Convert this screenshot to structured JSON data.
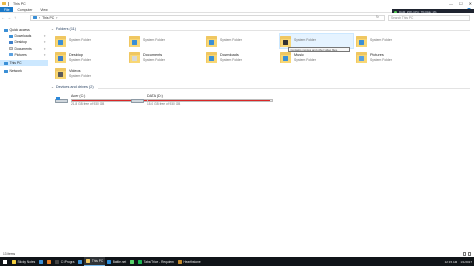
{
  "window": {
    "title": "This PC",
    "controls": [
      "—",
      "☐",
      "✕"
    ]
  },
  "ribbon": {
    "tabs": [
      "File",
      "Computer",
      "View"
    ],
    "help": "?"
  },
  "address": {
    "back": "←",
    "forward": "→",
    "up": "↑",
    "path": "This PC",
    "chevron": "›",
    "refresh": "↻",
    "search_placeholder": "Search This PC"
  },
  "meter": {
    "text": "RAM: 25%  CPU: 7%  Disk: 1%"
  },
  "sidebar": {
    "items": [
      {
        "label": "Quick access",
        "icon": "star-icon",
        "pinned": false
      },
      {
        "label": "Downloads",
        "icon": "download-icon",
        "pinned": true
      },
      {
        "label": "Desktop",
        "icon": "desktop-icon",
        "pinned": true
      },
      {
        "label": "Documents",
        "icon": "document-icon",
        "pinned": true
      },
      {
        "label": "Pictures",
        "icon": "pictures-icon",
        "pinned": true
      },
      {
        "label": "This PC",
        "icon": "computer-icon",
        "pinned": false
      },
      {
        "label": "Network",
        "icon": "network-icon",
        "pinned": false
      }
    ]
  },
  "folders": {
    "header": "Folders (11)",
    "items": [
      {
        "name": "",
        "type": "System Folder",
        "glyph_color": "#3a8fd6"
      },
      {
        "name": "",
        "type": "System Folder",
        "glyph_color": "#3a8fd6"
      },
      {
        "name": "",
        "type": "System Folder",
        "glyph_color": "#3a8fd6"
      },
      {
        "name": "",
        "type": "System Folder",
        "glyph_color": "#3a8fd6"
      },
      {
        "name": "",
        "type": "System Folder",
        "glyph_color": "#333333"
      },
      {
        "name": "",
        "type": "System Folder",
        "glyph_color": "#3a8fd6"
      },
      {
        "name": "Desktop",
        "type": "System Folder",
        "glyph_color": "#3d7ec9"
      },
      {
        "name": "Documents",
        "type": "System Folder",
        "glyph_color": "#d8d8d8"
      },
      {
        "name": "Downloads",
        "type": "System Folder",
        "glyph_color": "#3a8fd6"
      },
      {
        "name": "Music",
        "type": "System Folder",
        "glyph_color": "#3a8fd6"
      },
      {
        "name": "Pictures",
        "type": "System Folder",
        "glyph_color": "#5aa0e0"
      },
      {
        "name": "Videos",
        "type": "System Folder",
        "glyph_color": "#5a5a5a"
      }
    ],
    "tooltip": "Contains movies and other video files."
  },
  "drives": {
    "header": "Devices and drives (2)",
    "items": [
      {
        "name": "Acer (C:)",
        "free": "21.8 GB free of 930 GB",
        "used_fraction": 0.98
      },
      {
        "name": "DATA (D:)",
        "free": "15.0 GB free of 930 GB",
        "used_fraction": 0.98
      }
    ]
  },
  "status": {
    "count": "13 items"
  },
  "taskbar": {
    "items": [
      {
        "label": "Sticky Notes",
        "color": "#f4d03f",
        "active": false
      },
      {
        "label": "",
        "color": "#3a8fd6",
        "active": false
      },
      {
        "label": "",
        "color": "#e67e22",
        "active": false
      },
      {
        "label": "C:\\Progra",
        "color": "#444444",
        "active": false
      },
      {
        "label": "",
        "color": "#3a8fd6",
        "active": false
      },
      {
        "label": "This PC",
        "color": "#f0c761",
        "active": true
      },
      {
        "label": "Battle.net",
        "color": "#2a8cd8",
        "active": false
      },
      {
        "label": "",
        "color": "#58d26b",
        "active": false
      },
      {
        "label": "Tabs/Trice - Requiem",
        "color": "#1db954",
        "active": false
      },
      {
        "label": "Hearthstone",
        "color": "#c58a2c",
        "active": false
      }
    ],
    "tray": {
      "time": "12:15 AM",
      "date": "1/1/2017"
    }
  }
}
